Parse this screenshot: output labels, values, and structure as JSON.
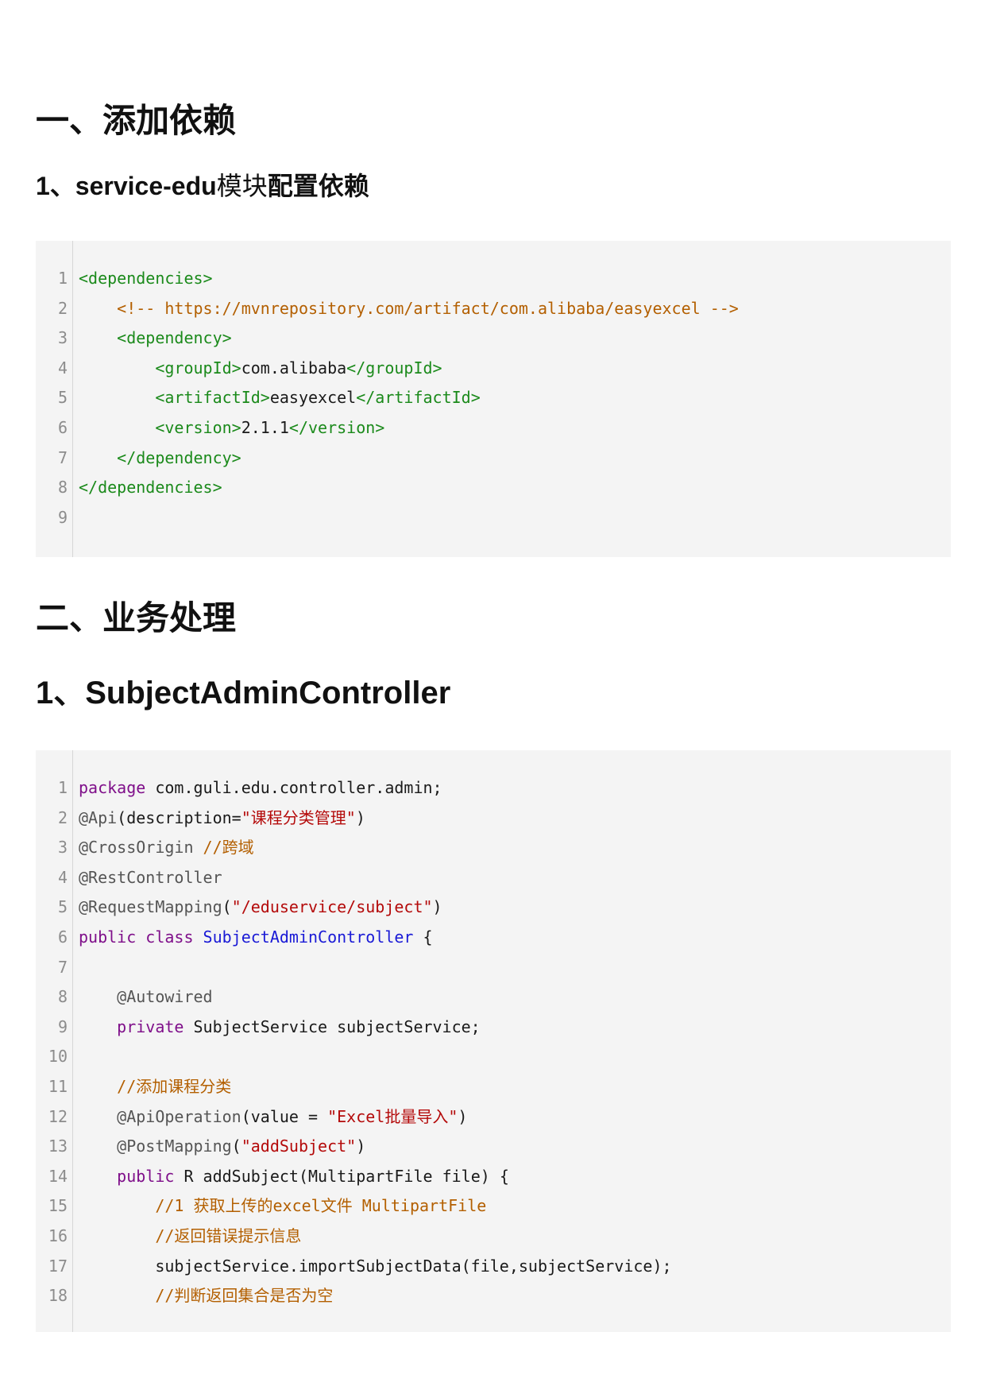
{
  "sections": [
    {
      "heading": "一、添加依赖",
      "subheading_parts": [
        "1、service-edu",
        "模块",
        "配置依赖"
      ]
    },
    {
      "heading": "二、业务处理",
      "subheading": "1、SubjectAdminController"
    }
  ],
  "code_blocks": [
    {
      "lines": [
        {
          "n": "1",
          "tokens": [
            {
              "t": "<dependencies>",
              "c": "tag"
            }
          ]
        },
        {
          "n": "2",
          "tokens": [
            {
              "t": "    <!-- https://mvnrepository.com/artifact/com.alibaba/easyexcel -->",
              "c": "com"
            }
          ]
        },
        {
          "n": "3",
          "tokens": [
            {
              "t": "    <dependency>",
              "c": "tag"
            }
          ]
        },
        {
          "n": "4",
          "tokens": [
            {
              "t": "        <groupId>",
              "c": "tag"
            },
            {
              "t": "com.alibaba",
              "c": "txt"
            },
            {
              "t": "</groupId>",
              "c": "tag"
            }
          ]
        },
        {
          "n": "5",
          "tokens": [
            {
              "t": "        <artifactId>",
              "c": "tag"
            },
            {
              "t": "easyexcel",
              "c": "txt"
            },
            {
              "t": "</artifactId>",
              "c": "tag"
            }
          ]
        },
        {
          "n": "6",
          "tokens": [
            {
              "t": "        <version>",
              "c": "tag"
            },
            {
              "t": "2.1.1",
              "c": "txt"
            },
            {
              "t": "</version>",
              "c": "tag"
            }
          ]
        },
        {
          "n": "7",
          "tokens": [
            {
              "t": "    </dependency>",
              "c": "tag"
            }
          ]
        },
        {
          "n": "8",
          "tokens": [
            {
              "t": "</dependencies>",
              "c": "tag"
            }
          ]
        },
        {
          "n": "9",
          "tokens": []
        }
      ]
    },
    {
      "lines": [
        {
          "n": "1",
          "tokens": [
            {
              "t": "package",
              "c": "kw"
            },
            {
              "t": " com.guli.edu.controller.admin;",
              "c": "txt"
            }
          ]
        },
        {
          "n": "2",
          "tokens": [
            {
              "t": "@Api",
              "c": "ann"
            },
            {
              "t": "(description=",
              "c": "txt"
            },
            {
              "t": "\"课程分类管理\"",
              "c": "str"
            },
            {
              "t": ")",
              "c": "txt"
            }
          ]
        },
        {
          "n": "3",
          "tokens": [
            {
              "t": "@CrossOrigin",
              "c": "ann"
            },
            {
              "t": " ",
              "c": "txt"
            },
            {
              "t": "//跨域",
              "c": "com"
            }
          ]
        },
        {
          "n": "4",
          "tokens": [
            {
              "t": "@RestController",
              "c": "ann"
            }
          ]
        },
        {
          "n": "5",
          "tokens": [
            {
              "t": "@RequestMapping",
              "c": "ann"
            },
            {
              "t": "(",
              "c": "txt"
            },
            {
              "t": "\"/eduservice/subject\"",
              "c": "str"
            },
            {
              "t": ")",
              "c": "txt"
            }
          ]
        },
        {
          "n": "6",
          "tokens": [
            {
              "t": "public class",
              "c": "kw"
            },
            {
              "t": " ",
              "c": "txt"
            },
            {
              "t": "SubjectAdminController",
              "c": "cls"
            },
            {
              "t": " {",
              "c": "txt"
            }
          ]
        },
        {
          "n": "7",
          "tokens": []
        },
        {
          "n": "8",
          "tokens": [
            {
              "t": "    @Autowired",
              "c": "ann"
            }
          ]
        },
        {
          "n": "9",
          "tokens": [
            {
              "t": "    private",
              "c": "kw"
            },
            {
              "t": " SubjectService subjectService;",
              "c": "txt"
            }
          ]
        },
        {
          "n": "10",
          "tokens": []
        },
        {
          "n": "11",
          "tokens": [
            {
              "t": "    //添加课程分类",
              "c": "com"
            }
          ]
        },
        {
          "n": "12",
          "tokens": [
            {
              "t": "    @ApiOperation",
              "c": "ann"
            },
            {
              "t": "(value = ",
              "c": "txt"
            },
            {
              "t": "\"Excel批量导入\"",
              "c": "str"
            },
            {
              "t": ")",
              "c": "txt"
            }
          ]
        },
        {
          "n": "13",
          "tokens": [
            {
              "t": "    @PostMapping",
              "c": "ann"
            },
            {
              "t": "(",
              "c": "txt"
            },
            {
              "t": "\"addSubject\"",
              "c": "str"
            },
            {
              "t": ")",
              "c": "txt"
            }
          ]
        },
        {
          "n": "14",
          "tokens": [
            {
              "t": "    public",
              "c": "kw"
            },
            {
              "t": " R addSubject(MultipartFile file) {",
              "c": "txt"
            }
          ]
        },
        {
          "n": "15",
          "tokens": [
            {
              "t": "        //1 获取上传的excel文件 MultipartFile",
              "c": "com"
            }
          ]
        },
        {
          "n": "16",
          "tokens": [
            {
              "t": "        //返回错误提示信息",
              "c": "com"
            }
          ]
        },
        {
          "n": "17",
          "tokens": [
            {
              "t": "        subjectService.importSubjectData(file,subjectService);",
              "c": "txt"
            }
          ]
        },
        {
          "n": "18",
          "tokens": [
            {
              "t": "        //判断返回集合是否为空",
              "c": "com"
            }
          ]
        }
      ]
    }
  ]
}
